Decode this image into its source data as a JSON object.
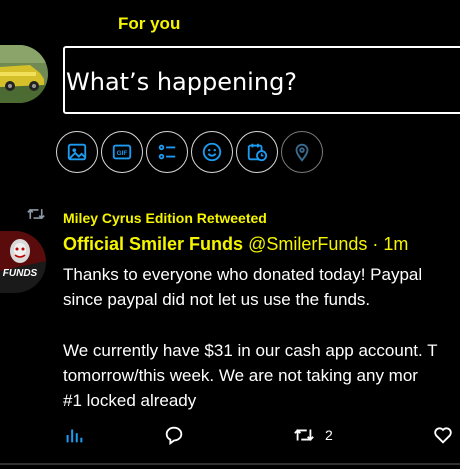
{
  "tabs": {
    "for_you": "For you"
  },
  "compose": {
    "placeholder": "What’s happening?",
    "tools": [
      {
        "icon": "image-icon",
        "enabled": true
      },
      {
        "icon": "gif-icon",
        "enabled": true,
        "label": "GIF"
      },
      {
        "icon": "poll-icon",
        "enabled": true
      },
      {
        "icon": "emoji-icon",
        "enabled": true
      },
      {
        "icon": "schedule-icon",
        "enabled": true
      },
      {
        "icon": "location-icon",
        "enabled": false
      }
    ]
  },
  "tweet": {
    "retweet_context": "Miley Cyrus Edition Retweeted",
    "author_name": "Official Smiler Funds",
    "handle": "@SmilerFunds",
    "separator": "·",
    "time": "1m",
    "avatar_text": "FUNDS",
    "body_lines": [
      "Thanks to everyone who donated today! Paypal",
      "since paypal did not let us use the funds.",
      "",
      "We currently have $31 in our cash app account. T",
      "tomorrow/this week. We are not taking any mor",
      "#1 locked already"
    ],
    "actions": {
      "retweet_count": "2"
    }
  },
  "colors": {
    "accent_yellow": "#f5f500",
    "icon_blue": "#1d9bf0",
    "background": "#000000"
  }
}
